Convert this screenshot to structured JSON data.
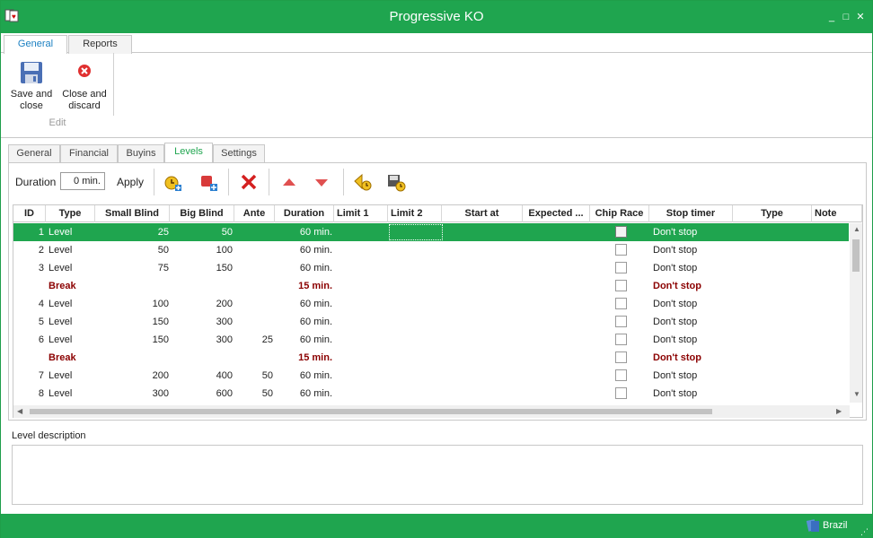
{
  "window": {
    "title": "Progressive KO",
    "minimize": "_",
    "maximize": "□",
    "close": "✕"
  },
  "ribbon": {
    "tabs": [
      "General",
      "Reports"
    ],
    "save_label": "Save and close",
    "close_label": "Close and discard",
    "group_label": "Edit"
  },
  "tabs": [
    "General",
    "Financial",
    "Buyins",
    "Levels",
    "Settings"
  ],
  "toolbar": {
    "duration_label": "Duration",
    "duration_value": "0 min.",
    "apply_label": "Apply"
  },
  "grid": {
    "columns": [
      "ID",
      "Type",
      "Small Blind",
      "Big Blind",
      "Ante",
      "Duration",
      "Limit 1",
      "Limit 2",
      "Start at",
      "Expected ...",
      "Chip Race",
      "Stop timer",
      "Type",
      "Note"
    ],
    "rows": [
      {
        "id": "1",
        "type": "Level",
        "sb": "25",
        "bb": "50",
        "ante": "",
        "duration": "60 min.",
        "stop": "Don't stop",
        "brk": false
      },
      {
        "id": "2",
        "type": "Level",
        "sb": "50",
        "bb": "100",
        "ante": "",
        "duration": "60 min.",
        "stop": "Don't stop",
        "brk": false
      },
      {
        "id": "3",
        "type": "Level",
        "sb": "75",
        "bb": "150",
        "ante": "",
        "duration": "60 min.",
        "stop": "Don't stop",
        "brk": false
      },
      {
        "id": "",
        "type": "Break",
        "sb": "",
        "bb": "",
        "ante": "",
        "duration": "15 min.",
        "stop": "Don't stop",
        "brk": true
      },
      {
        "id": "4",
        "type": "Level",
        "sb": "100",
        "bb": "200",
        "ante": "",
        "duration": "60 min.",
        "stop": "Don't stop",
        "brk": false
      },
      {
        "id": "5",
        "type": "Level",
        "sb": "150",
        "bb": "300",
        "ante": "",
        "duration": "60 min.",
        "stop": "Don't stop",
        "brk": false
      },
      {
        "id": "6",
        "type": "Level",
        "sb": "150",
        "bb": "300",
        "ante": "25",
        "duration": "60 min.",
        "stop": "Don't stop",
        "brk": false
      },
      {
        "id": "",
        "type": "Break",
        "sb": "",
        "bb": "",
        "ante": "",
        "duration": "15 min.",
        "stop": "Don't stop",
        "brk": true
      },
      {
        "id": "7",
        "type": "Level",
        "sb": "200",
        "bb": "400",
        "ante": "50",
        "duration": "60 min.",
        "stop": "Don't stop",
        "brk": false
      },
      {
        "id": "8",
        "type": "Level",
        "sb": "300",
        "bb": "600",
        "ante": "50",
        "duration": "60 min.",
        "stop": "Don't stop",
        "brk": false
      }
    ]
  },
  "description": {
    "label": "Level description",
    "value": ""
  },
  "status": {
    "language": "Brazil"
  },
  "colors": {
    "accent": "#1fa54f",
    "break_text": "#8b0000"
  }
}
